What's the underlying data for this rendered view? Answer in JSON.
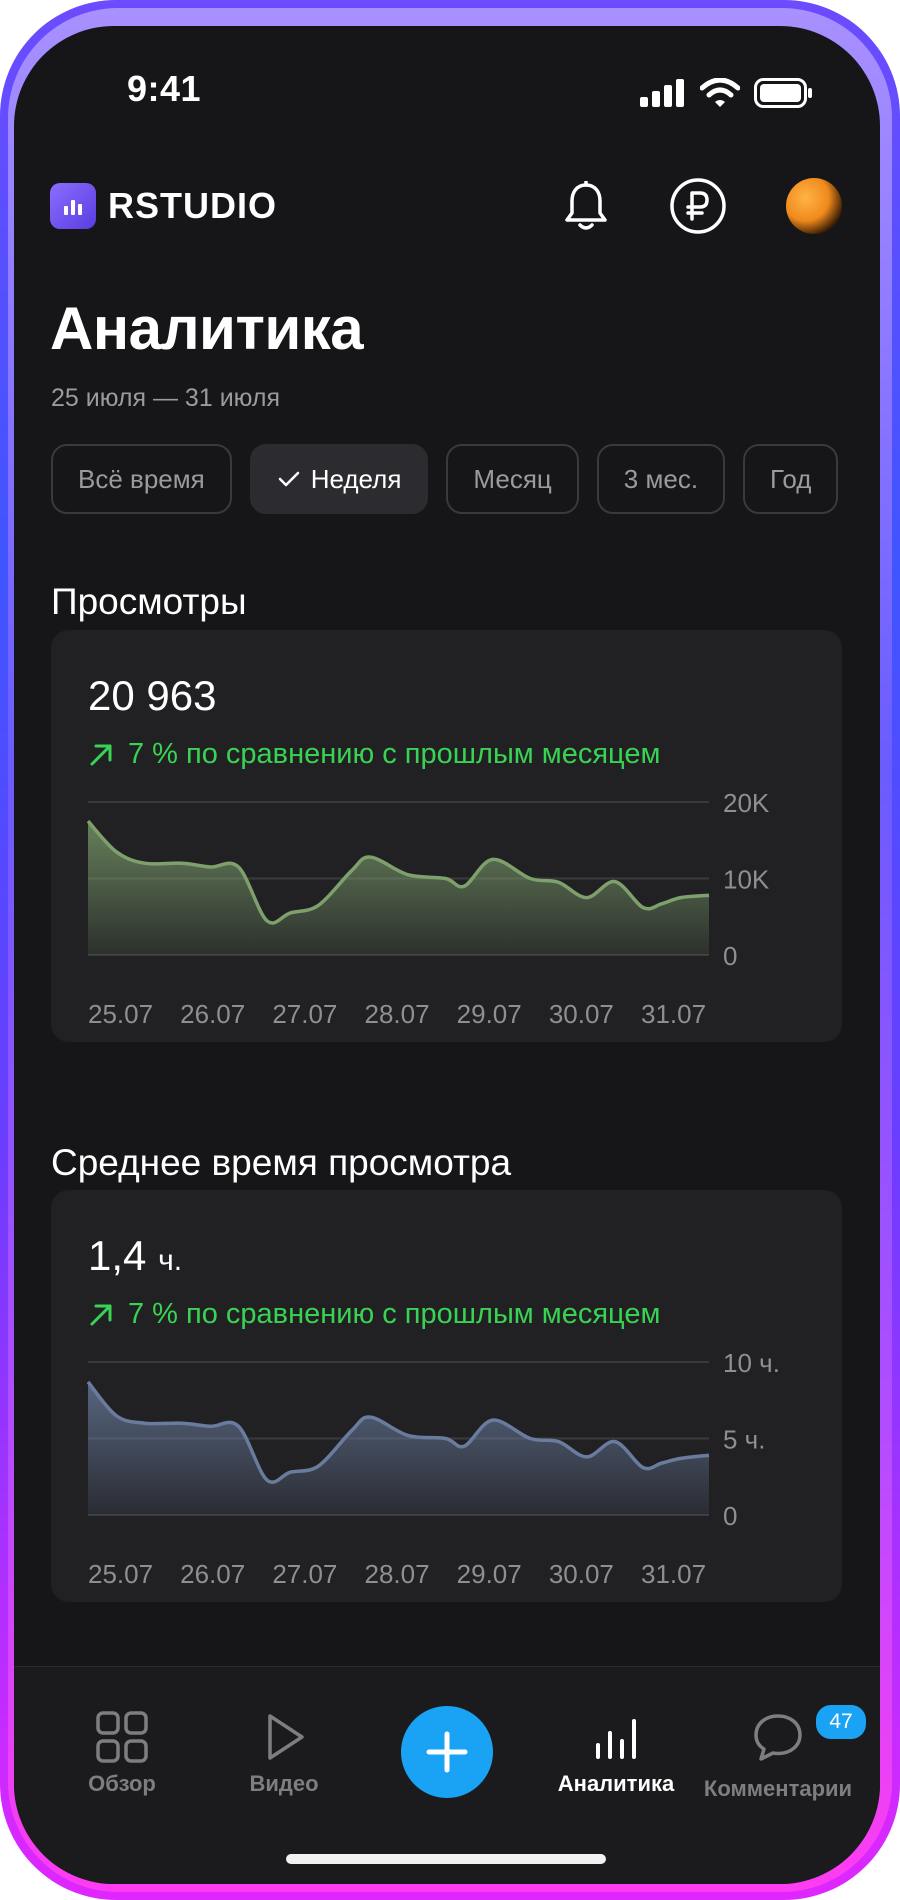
{
  "status_bar": {
    "time": "9:41"
  },
  "header": {
    "brand": "RSTUDIO"
  },
  "page": {
    "title": "Аналитика",
    "date_range": "25 июля — 31 июля"
  },
  "period_tabs": [
    {
      "label": "Всё время",
      "active": false
    },
    {
      "label": "Неделя",
      "active": true
    },
    {
      "label": "Месяц",
      "active": false
    },
    {
      "label": "3 мес.",
      "active": false
    },
    {
      "label": "Год",
      "active": false
    }
  ],
  "views": {
    "section_title": "Просмотры",
    "value": "20 963",
    "delta": "7 % по сравнению с прошлым месяцем"
  },
  "avg_time": {
    "section_title": "Среднее время просмотра",
    "value": "1,4",
    "unit": "ч.",
    "delta": "7 % по сравнению с прошлым месяцем"
  },
  "nav": {
    "overview": "Обзор",
    "video": "Видео",
    "analytics": "Аналитика",
    "comments": "Комментарии",
    "comments_badge": "47"
  },
  "colors": {
    "accent": "#1aa3f5",
    "positive": "#39d353",
    "views_line": "#7ea06d",
    "time_line": "#6a7c9e"
  },
  "chart_data": [
    {
      "type": "area",
      "categories": [
        "25.07",
        "26.07",
        "27.07",
        "28.07",
        "29.07",
        "30.07",
        "31.07"
      ],
      "y_ticks": [
        "20K",
        "10K",
        "0"
      ],
      "ylim": [
        0,
        20000
      ],
      "grid": true,
      "x": [
        0,
        0.3,
        0.6,
        1.0,
        1.3,
        1.6,
        1.9,
        2.15,
        2.45,
        2.8,
        3.0,
        3.4,
        3.8,
        4.0,
        4.3,
        4.7,
        5.0,
        5.3,
        5.6,
        5.9,
        6.1,
        6.3,
        6.6
      ],
      "values": [
        17500,
        13500,
        12000,
        12000,
        11500,
        11500,
        4500,
        5500,
        6500,
        11000,
        12800,
        10500,
        10000,
        9000,
        12500,
        10000,
        9500,
        7500,
        9600,
        6200,
        6700,
        7500,
        7800
      ]
    },
    {
      "type": "area",
      "categories": [
        "25.07",
        "26.07",
        "27.07",
        "28.07",
        "29.07",
        "30.07",
        "31.07"
      ],
      "y_ticks": [
        "10 ч.",
        "5 ч.",
        "0"
      ],
      "ylim": [
        0,
        10
      ],
      "grid": true,
      "x": [
        0,
        0.3,
        0.6,
        1.0,
        1.3,
        1.6,
        1.9,
        2.15,
        2.45,
        2.8,
        3.0,
        3.4,
        3.8,
        4.0,
        4.3,
        4.7,
        5.0,
        5.3,
        5.6,
        5.9,
        6.1,
        6.3,
        6.6
      ],
      "values": [
        8.7,
        6.5,
        6.0,
        6.0,
        5.8,
        5.8,
        2.3,
        2.8,
        3.2,
        5.5,
        6.4,
        5.2,
        5.0,
        4.5,
        6.2,
        5.0,
        4.8,
        3.8,
        4.8,
        3.1,
        3.4,
        3.7,
        3.9
      ]
    }
  ]
}
